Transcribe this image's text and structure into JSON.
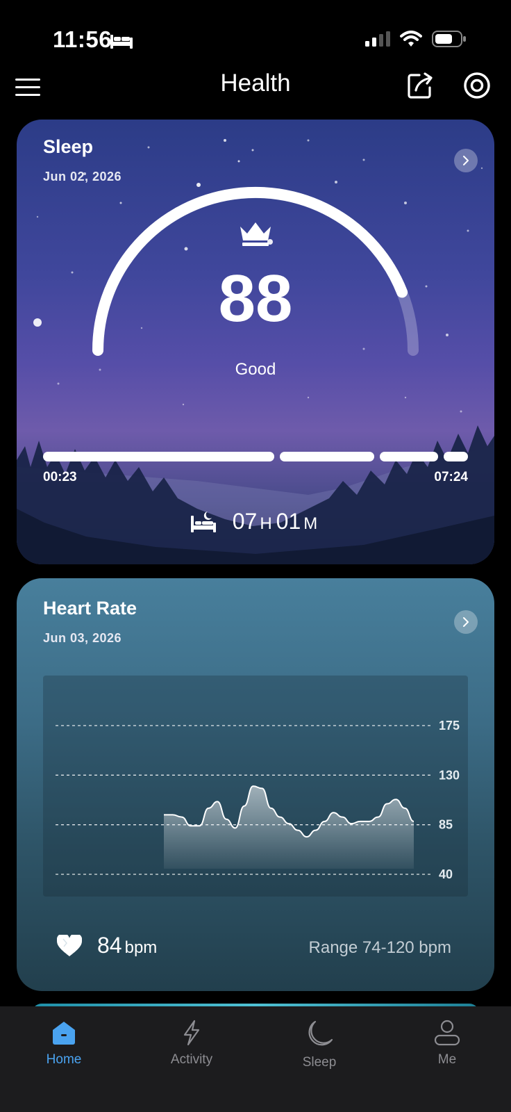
{
  "status_bar": {
    "time": "11:56"
  },
  "header": {
    "title": "Health"
  },
  "sleep": {
    "title": "Sleep",
    "date": "Jun 02, 2026",
    "score": "88",
    "score_fraction": 0.88,
    "rating": "Good",
    "start_time": "00:23",
    "end_time": "07:24",
    "duration_hours": "07",
    "duration_hours_unit": "H",
    "duration_minutes": "01",
    "duration_minutes_unit": "M"
  },
  "heart_rate": {
    "title": "Heart Rate",
    "date": "Jun 03, 2026",
    "current_value": "84",
    "current_unit": "bpm",
    "range_text": "Range 74-120 bpm"
  },
  "chart_data": {
    "type": "area",
    "y_ticks": [
      175,
      130,
      85,
      40
    ],
    "ylim": [
      40,
      175
    ],
    "grid": true,
    "values": [
      94,
      94,
      92,
      84,
      84,
      100,
      106,
      90,
      82,
      102,
      120,
      118,
      100,
      92,
      86,
      80,
      74,
      80,
      88,
      96,
      92,
      86,
      88,
      88,
      92,
      104,
      108,
      100,
      88
    ]
  },
  "tabs": [
    {
      "label": "Home",
      "icon": "home-icon",
      "active": true
    },
    {
      "label": "Activity",
      "icon": "lightning-icon",
      "active": false
    },
    {
      "label": "Sleep",
      "icon": "moon-icon",
      "active": false
    },
    {
      "label": "Me",
      "icon": "person-icon",
      "active": false
    }
  ],
  "colors": {
    "accent": "#4aa3f0",
    "tab_inactive": "#8d8d92"
  }
}
